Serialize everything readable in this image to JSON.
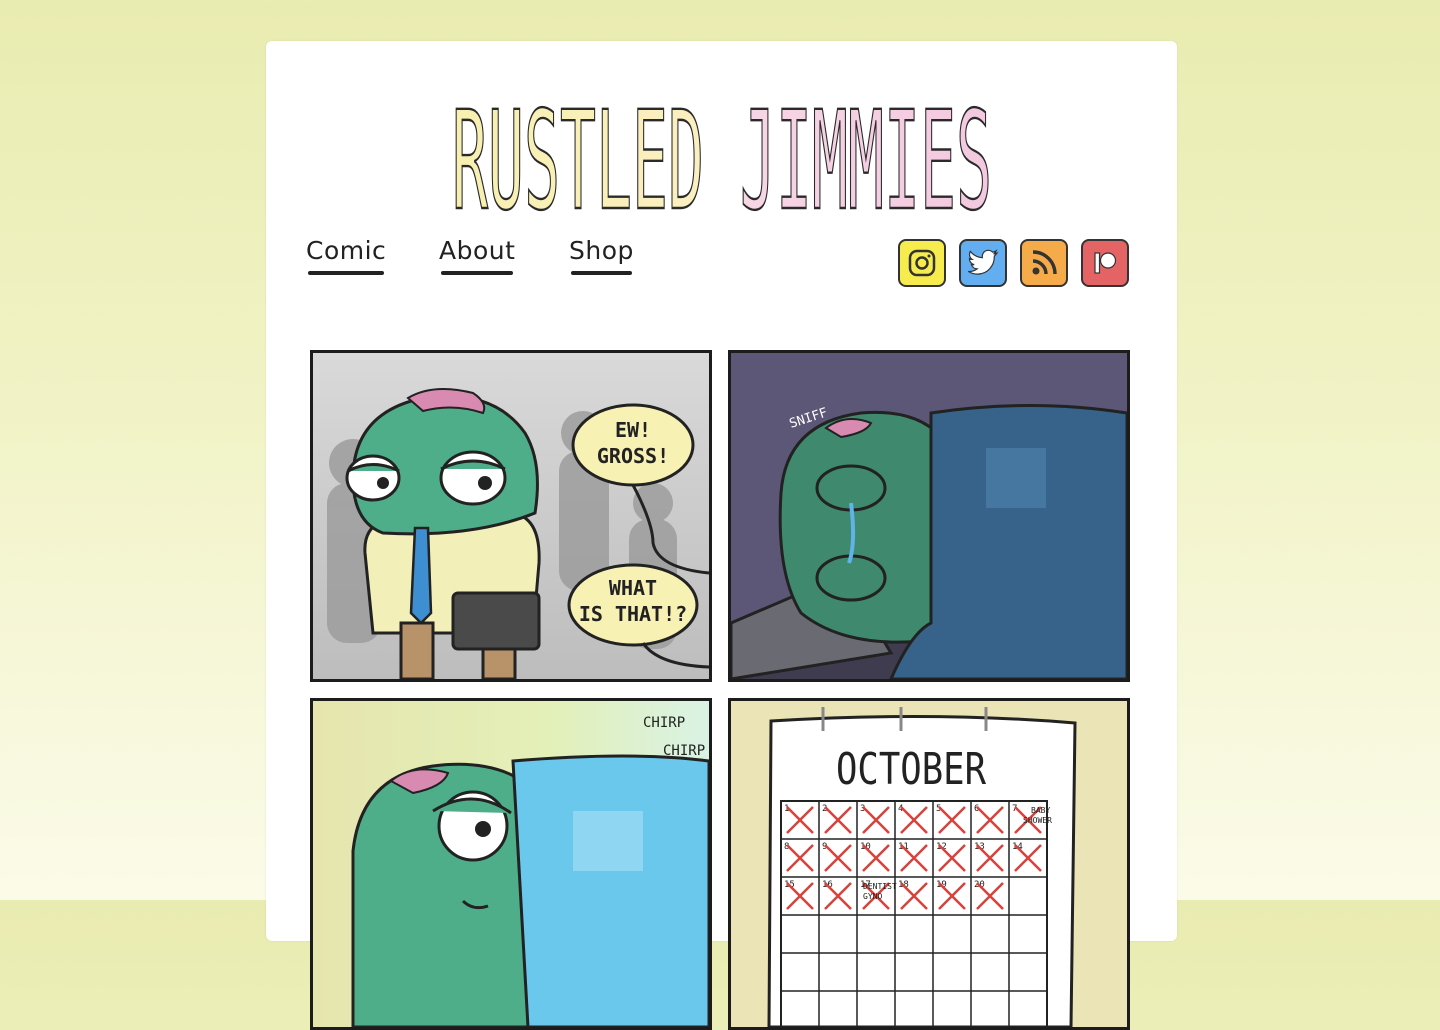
{
  "site": {
    "title": "RUSTLED JIMMIES"
  },
  "nav": [
    {
      "label": "Comic"
    },
    {
      "label": "About"
    },
    {
      "label": "Shop"
    }
  ],
  "social": [
    {
      "name": "instagram-icon",
      "color": "#f7ec4d"
    },
    {
      "name": "twitter-icon",
      "color": "#62aef0"
    },
    {
      "name": "rss-icon",
      "color": "#f6ab4a"
    },
    {
      "name": "patreon-icon",
      "color": "#e46466"
    }
  ],
  "comic": {
    "panel1": {
      "bubble1": [
        "EW!",
        "GROSS!"
      ],
      "bubble2": [
        "WHAT",
        "IS THAT!?"
      ]
    },
    "panel2": {
      "sfx": "SNIFF"
    },
    "panel3": {
      "sfx": [
        "CHIRP",
        "CHIRP"
      ]
    },
    "panel4": {
      "month": "OCTOBER",
      "notes": [
        "BABY",
        "SHOWER",
        "DENTIST",
        "GYNO"
      ],
      "days": [
        "1",
        "2",
        "3",
        "4",
        "5",
        "6",
        "7",
        "8",
        "9",
        "10",
        "11",
        "12",
        "13",
        "14",
        "15",
        "16",
        "17",
        "18",
        "19",
        "20"
      ]
    }
  }
}
